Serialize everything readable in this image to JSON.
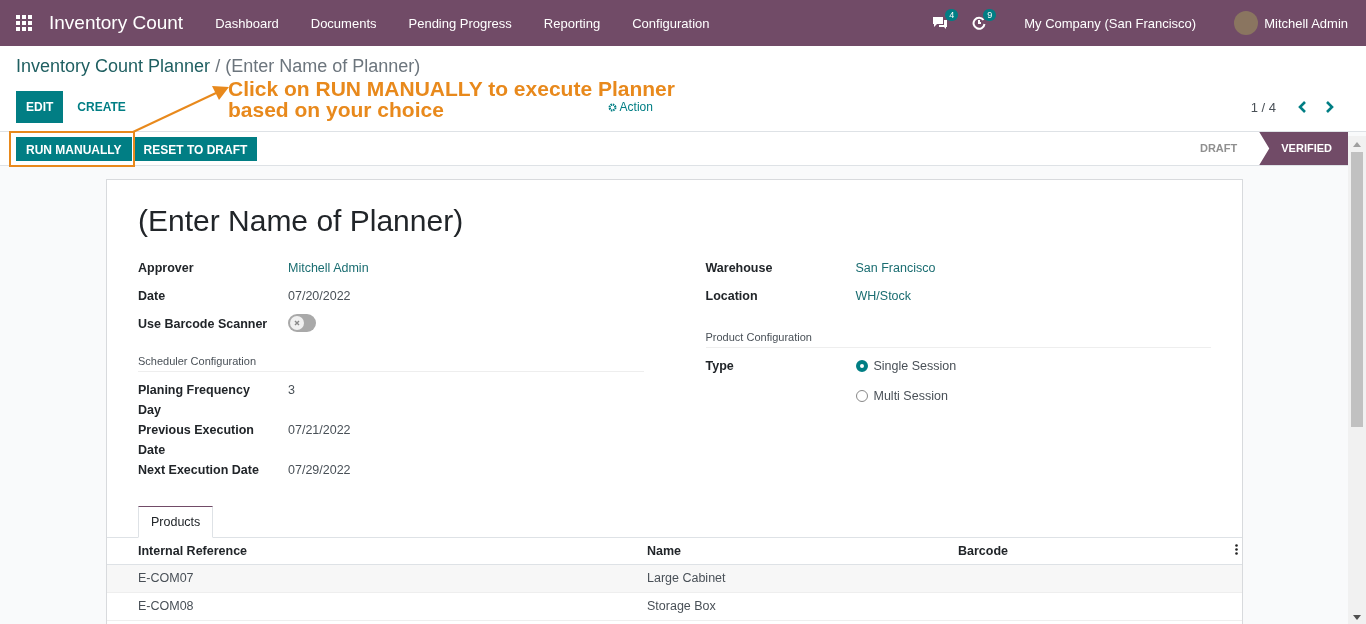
{
  "navbar": {
    "app_name": "Inventory Count",
    "menu": [
      "Dashboard",
      "Documents",
      "Pending Progress",
      "Reporting",
      "Configuration"
    ],
    "messages_count": "4",
    "activities_count": "9",
    "company": "My Company (San Francisco)",
    "user": "Mitchell Admin"
  },
  "breadcrumb": {
    "parent": "Inventory Count Planner",
    "separator": "/",
    "current": "(Enter Name of Planner)"
  },
  "control_panel": {
    "buttons": [
      "EDIT",
      "CREATE"
    ],
    "action": "Action",
    "pager": "1 / 4"
  },
  "annotation": {
    "lines": [
      "Click on RUN MANUALLY to execute Planner",
      "based on your choice"
    ]
  },
  "status_bar": {
    "buttons": [
      "RUN MANUALLY",
      "RESET TO DRAFT"
    ],
    "stages": [
      {
        "label": "DRAFT",
        "selected": false
      },
      {
        "label": "VERIFIED",
        "selected": true
      }
    ]
  },
  "form": {
    "title": "(Enter Name of Planner)",
    "left_fields": [
      {
        "label": "Approver",
        "value": "Mitchell Admin",
        "kind": "link"
      },
      {
        "label": "Date",
        "value": "07/20/2022",
        "kind": "text"
      },
      {
        "label": "Use Barcode Scanner",
        "kind": "toggle",
        "on": false
      }
    ],
    "scheduler_section": "Scheduler Configuration",
    "scheduler_fields": [
      {
        "label": "Planing Frequency Day",
        "value": "3"
      },
      {
        "label": "Previous Execution Date",
        "value": "07/21/2022"
      },
      {
        "label": "Next Execution Date",
        "value": "07/29/2022"
      }
    ],
    "right_fields": [
      {
        "label": "Warehouse",
        "value": "San Francisco"
      },
      {
        "label": "Location",
        "value": "WH/Stock"
      }
    ],
    "product_section": "Product Configuration",
    "type": {
      "label": "Type",
      "options": [
        {
          "label": "Single Session",
          "selected": true
        },
        {
          "label": "Multi Session",
          "selected": false
        }
      ]
    }
  },
  "tabs": [
    {
      "label": "Products",
      "selected": true
    }
  ],
  "table": {
    "columns": [
      "Internal Reference",
      "Name",
      "Barcode"
    ],
    "rows": [
      {
        "internal_reference": "E-COM07",
        "name": "Large Cabinet"
      },
      {
        "internal_reference": "E-COM08",
        "name": "Storage Box"
      }
    ]
  }
}
